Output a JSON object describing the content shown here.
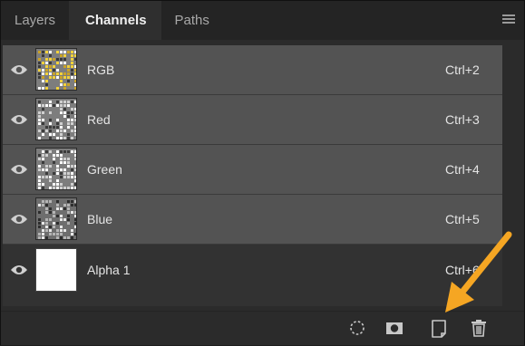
{
  "tabs": [
    {
      "label": "Layers",
      "active": false
    },
    {
      "label": "Channels",
      "active": true
    },
    {
      "label": "Paths",
      "active": false
    }
  ],
  "channels": [
    {
      "name": "RGB",
      "shortcut": "Ctrl+2",
      "thumb": "rgb-composite"
    },
    {
      "name": "Red",
      "shortcut": "Ctrl+3",
      "thumb": "grayscale"
    },
    {
      "name": "Green",
      "shortcut": "Ctrl+4",
      "thumb": "grayscale"
    },
    {
      "name": "Blue",
      "shortcut": "Ctrl+5",
      "thumb": "grayscale-dark"
    },
    {
      "name": "Alpha 1",
      "shortcut": "Ctrl+6",
      "thumb": "white"
    }
  ],
  "toolbar": {
    "icons": [
      "load-selection-icon",
      "save-selection-icon",
      "new-channel-icon",
      "delete-channel-icon"
    ]
  },
  "colors": {
    "panel_bg": "#2b2b2b",
    "row_bg": "#535353",
    "alpha_row_bg": "#323232",
    "text": "#e4e4e4",
    "annotation_arrow": "#f5a623"
  }
}
